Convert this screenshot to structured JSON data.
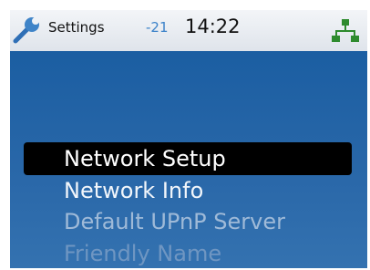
{
  "status_bar": {
    "icon": "wrench-icon",
    "title": "Settings",
    "signal": "-21",
    "clock": "14:22",
    "network_icon": "network-icon",
    "network_color": "#2e8b2e"
  },
  "menu": {
    "items": [
      {
        "label": "Network Setup",
        "state": "selected"
      },
      {
        "label": "Network Info",
        "state": "normal"
      },
      {
        "label": "Default UPnP Server",
        "state": "dim"
      },
      {
        "label": "Friendly Name",
        "state": "faint"
      }
    ]
  },
  "colors": {
    "background": "#2a66a6",
    "selection": "#000000"
  }
}
